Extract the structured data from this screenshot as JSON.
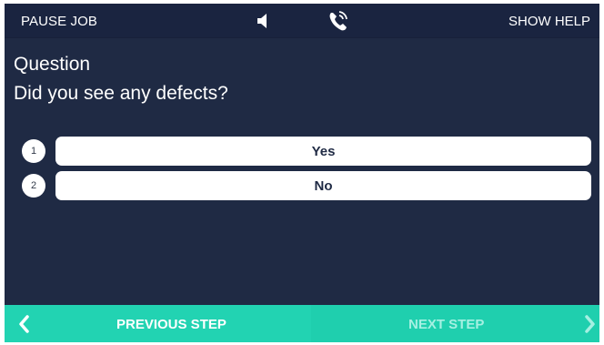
{
  "topbar": {
    "pause_label": "PAUSE JOB",
    "help_label": "SHOW HELP",
    "speaker_icon": "speaker-icon",
    "phone_icon": "phone-call-icon"
  },
  "question": {
    "heading": "Question",
    "text": "Did you see any defects?"
  },
  "options": [
    {
      "number": "1",
      "label": "Yes"
    },
    {
      "number": "2",
      "label": "No"
    }
  ],
  "footer": {
    "prev_label": "PREVIOUS STEP",
    "next_label": "NEXT STEP",
    "prev_icon": "chevron-left-icon",
    "next_icon": "chevron-right-icon"
  },
  "colors": {
    "background": "#1f2a44",
    "topbar": "#1a2440",
    "accent": "#22d3b2",
    "disabled_text": "#a5f0e2"
  }
}
